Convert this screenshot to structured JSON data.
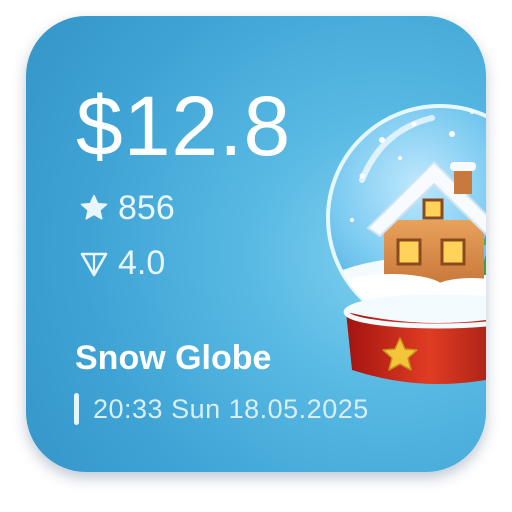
{
  "gift": {
    "price": "$12.8",
    "stars": "856",
    "tier": "4.0",
    "name": "Snow Globe",
    "datetime": "20:33 Sun 18.05.2025"
  },
  "icons": {
    "stars": "star-icon",
    "tier": "triangle-gem-icon",
    "item": "snow-globe-icon"
  },
  "colors": {
    "card_bg": "#4aaedb",
    "text_primary": "#ffffff",
    "text_secondary": "#d8eef9",
    "globe_base": "#d02a1e",
    "base_star": "#f2c53a"
  }
}
